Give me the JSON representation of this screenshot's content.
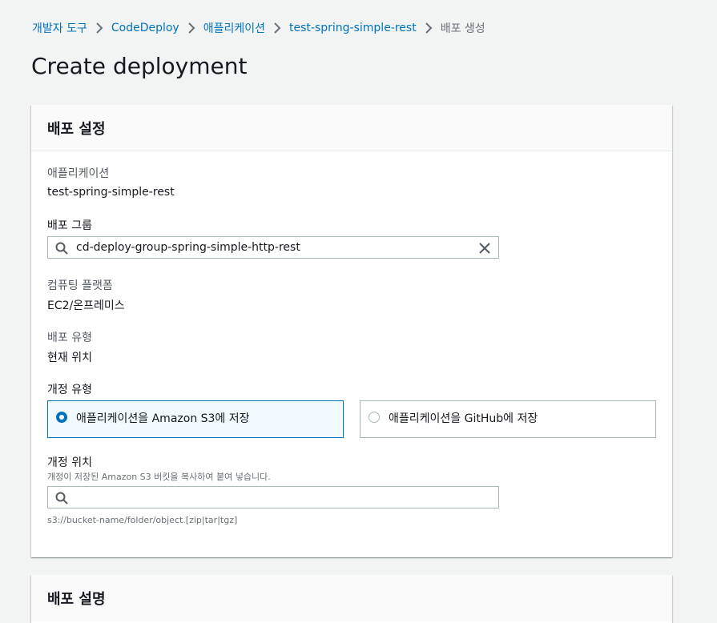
{
  "breadcrumb": [
    {
      "label": "개발자 도구"
    },
    {
      "label": "CodeDeploy"
    },
    {
      "label": "애플리케이션"
    },
    {
      "label": "test-spring-simple-rest"
    },
    {
      "label": "배포 생성"
    }
  ],
  "page_title": "Create deployment",
  "deployment_settings": {
    "header": "배포 설정",
    "application": {
      "label": "애플리케이션",
      "value": "test-spring-simple-rest"
    },
    "deployment_group": {
      "label": "배포 그룹",
      "value": "cd-deploy-group-spring-simple-http-rest",
      "icon": "search-icon",
      "clear_icon": "close-icon"
    },
    "compute_platform": {
      "label": "컴퓨팅 플랫폼",
      "value": "EC2/온프레미스"
    },
    "deployment_type": {
      "label": "배포 유형",
      "value": "현재 위치"
    },
    "revision_type": {
      "label": "개정 유형",
      "options": [
        {
          "label": "애플리케이션을 Amazon S3에 저장",
          "selected": true
        },
        {
          "label": "애플리케이션을 GitHub에 저장",
          "selected": false
        }
      ]
    },
    "revision_location": {
      "label": "개정 위치",
      "description": "개정이 저장된 Amazon S3 버킷을 복사하여 붙여 넣습니다.",
      "value": "",
      "icon": "search-icon",
      "constraint": "s3://bucket-name/folder/object.[zip|tar|tgz]"
    }
  },
  "deployment_description": {
    "header": "배포 설명"
  },
  "colors": {
    "link": "#0073bb",
    "background": "#f2f3f3",
    "selected_tile": "#f1faff",
    "text": "#16191f",
    "muted": "#687078"
  }
}
